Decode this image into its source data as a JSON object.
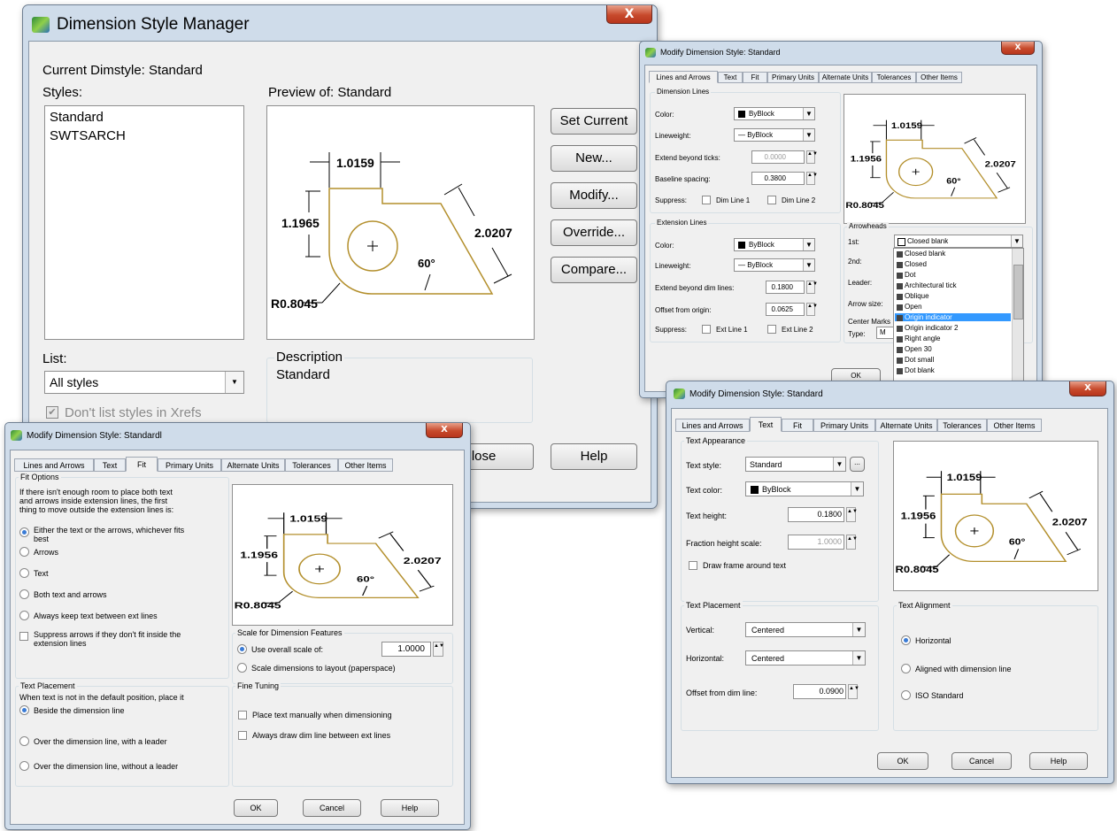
{
  "dsm": {
    "title": "Dimension Style Manager",
    "close_x": "X",
    "current_dimstyle": "Current Dimstyle: Standard",
    "styles_label": "Styles:",
    "styles": [
      "Standard",
      "SWTSARCH"
    ],
    "preview_label": "Preview of: Standard",
    "buttons": {
      "set_current": "Set Current",
      "new": "New...",
      "modify": "Modify...",
      "override": "Override...",
      "compare": "Compare...",
      "close": "Close",
      "help": "Help"
    },
    "list_label": "List:",
    "list_value": "All styles",
    "xrefs_label": "Don't list styles in Xrefs",
    "description_label": "Description",
    "description_value": "Standard"
  },
  "preview": {
    "dim_top": "1.0159",
    "dim_left": "1.1956",
    "dim_right": "2.0207",
    "angle": "60°",
    "radius": "R0.8045"
  },
  "dsm_preview": {
    "dim_top": "1.0159",
    "dim_left": "1.1965",
    "dim_right": "2.0207",
    "angle": "60°",
    "radius": "R0.8045"
  },
  "lines_arrows": {
    "title": "Modify Dimension Style: Standard",
    "tabs": [
      "Lines and Arrows",
      "Text",
      "Fit",
      "Primary Units",
      "Alternate Units",
      "Tolerances",
      "Other Items"
    ],
    "dim_lines_title": "Dimension Lines",
    "color_label": "Color:",
    "color_value": "ByBlock",
    "lineweight_label": "Lineweight:",
    "lineweight_value": "— ByBlock",
    "extend_ticks_label": "Extend beyond ticks:",
    "extend_ticks_value": "0.0000",
    "baseline_label": "Baseline spacing:",
    "baseline_value": "0.3800",
    "suppress_label": "Suppress:",
    "dim_line1": "Dim Line 1",
    "dim_line2": "Dim Line 2",
    "ext_lines_title": "Extension Lines",
    "ext_color_label": "Color:",
    "ext_color_value": "ByBlock",
    "ext_lineweight_label": "Lineweight:",
    "ext_lineweight_value": "— ByBlock",
    "extend_dim_label": "Extend beyond dim lines:",
    "extend_dim_value": "0.1800",
    "offset_label": "Offset from origin:",
    "offset_value": "0.0625",
    "ext_suppress_label": "Suppress:",
    "ext_line1": "Ext Line 1",
    "ext_line2": "Ext Line 2",
    "arrowheads_title": "Arrowheads",
    "first_label": "1st:",
    "first_value": "Closed blank",
    "second_label": "2nd:",
    "leader_label": "Leader:",
    "arrow_size_label": "Arrow size:",
    "center_marks_label": "Center Marks",
    "type_label": "Type:",
    "type_value": "M",
    "arrow_options": [
      "Closed blank",
      "Closed",
      "Dot",
      "Architectural tick",
      "Oblique",
      "Open",
      "Origin indicator",
      "Origin indicator 2",
      "Right angle",
      "Open 30",
      "Dot small",
      "Dot blank"
    ],
    "ok": "OK"
  },
  "fit": {
    "title": "Modify Dimension Style: Standardl",
    "tabs": [
      "Lines and Arrows",
      "Text",
      "Fit",
      "Primary Units",
      "Alternate Units",
      "Tolerances",
      "Other Items"
    ],
    "fit_options_title": "Fit Options",
    "fit_intro": [
      "If there isn't enough room to place both text",
      "and arrows inside extension lines, the first",
      "thing to move outside the extension lines is:"
    ],
    "opt_either": [
      "Either the text or the arrows, whichever fits",
      "best"
    ],
    "opt_arrows": "Arrows",
    "opt_text": "Text",
    "opt_both": "Both text and arrows",
    "opt_keep": "Always keep text between ext lines",
    "opt_suppress": [
      "Suppress arrows if they don't fit inside the",
      "extension lines"
    ],
    "text_placement_title": "Text Placement",
    "tp_intro": "When text is not in the default position, place it",
    "tp_beside": "Beside the dimension line",
    "tp_over_leader": "Over the dimension line, with a leader",
    "tp_over_noleader": "Over the dimension line, without a leader",
    "scale_title": "Scale for Dimension Features",
    "use_overall": "Use overall scale of:",
    "overall_value": "1.0000",
    "scale_layout": "Scale dimensions to layout (paperspace)",
    "fine_title": "Fine Tuning",
    "fine_manual": "Place text manually when dimensioning",
    "fine_always": "Always draw dim line between ext lines",
    "ok": "OK",
    "cancel": "Cancel",
    "help": "Help"
  },
  "text": {
    "title": "Modify Dimension Style: Standard",
    "tabs": [
      "Lines and Arrows",
      "Text",
      "Fit",
      "Primary Units",
      "Alternate Units",
      "Tolerances",
      "Other Items"
    ],
    "appearance_title": "Text Appearance",
    "style_label": "Text style:",
    "style_value": "Standard",
    "style_btn": "...",
    "color_label": "Text color:",
    "color_value": "ByBlock",
    "height_label": "Text height:",
    "height_value": "0.1800",
    "fraction_label": "Fraction height scale:",
    "fraction_value": "1.0000",
    "frame_label": "Draw frame around text",
    "placement_title": "Text Placement",
    "vertical_label": "Vertical:",
    "vertical_value": "Centered",
    "horizontal_label": "Horizontal:",
    "horizontal_value": "Centered",
    "offset_label": "Offset from dim line:",
    "offset_value": "0.0900",
    "alignment_title": "Text Alignment",
    "align_horizontal": "Horizontal",
    "align_aligned": "Aligned with dimension line",
    "align_iso": "ISO Standard",
    "ok": "OK",
    "cancel": "Cancel",
    "help": "Help"
  }
}
